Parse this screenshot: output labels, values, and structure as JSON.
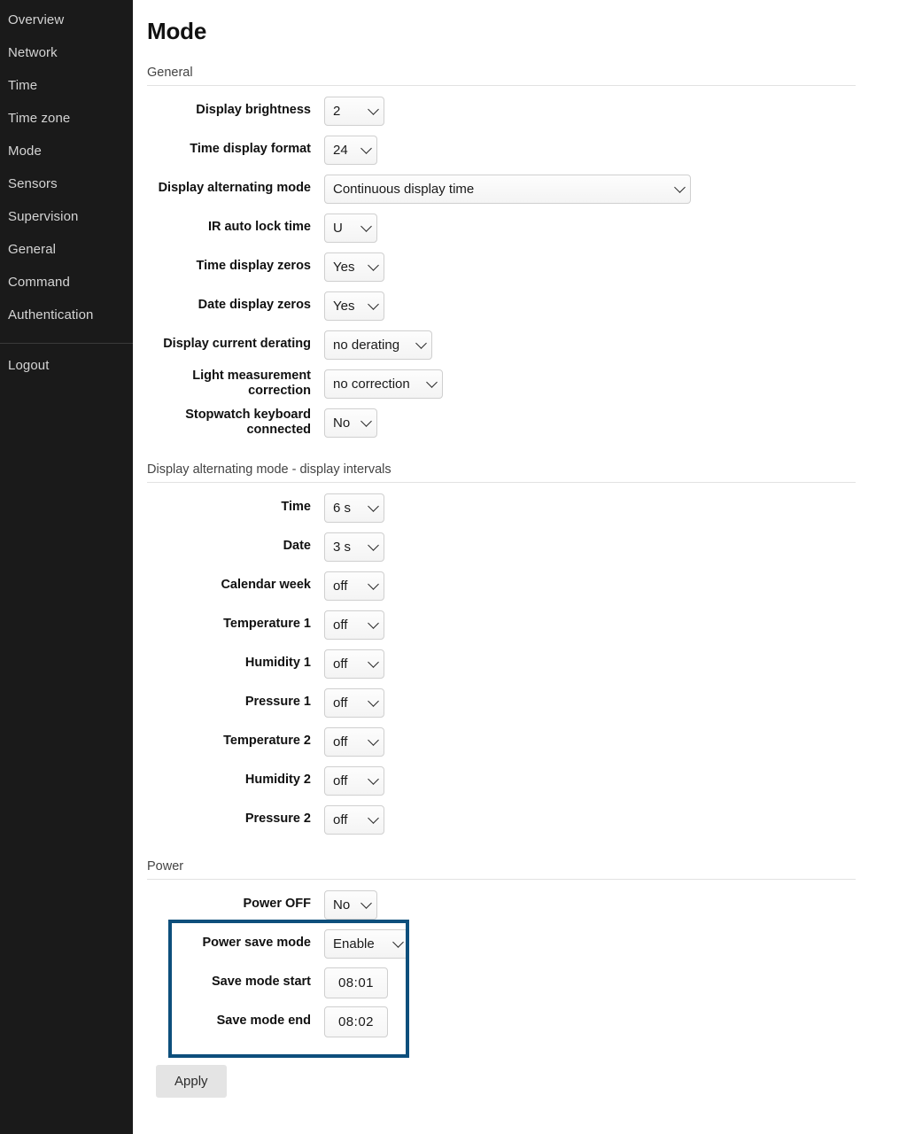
{
  "sidebar": {
    "items": [
      {
        "label": "Overview"
      },
      {
        "label": "Network"
      },
      {
        "label": "Time"
      },
      {
        "label": "Time zone"
      },
      {
        "label": "Mode"
      },
      {
        "label": "Sensors"
      },
      {
        "label": "Supervision"
      },
      {
        "label": "General"
      },
      {
        "label": "Command"
      },
      {
        "label": "Authentication"
      }
    ],
    "logout": "Logout"
  },
  "page": {
    "title": "Mode",
    "apply_label": "Apply",
    "highlight_color": "#0d4f7c"
  },
  "sections": {
    "general": {
      "heading": "General",
      "rows": [
        {
          "label": "Display brightness",
          "value": "2",
          "control": "select"
        },
        {
          "label": "Time display format",
          "value": "24",
          "control": "select"
        },
        {
          "label": "Display alternating mode",
          "value": "Continuous display time",
          "control": "select"
        },
        {
          "label": "IR auto lock time",
          "value": "U",
          "control": "select"
        },
        {
          "label": "Time display zeros",
          "value": "Yes",
          "control": "select"
        },
        {
          "label": "Date display zeros",
          "value": "Yes",
          "control": "select"
        },
        {
          "label": "Display current derating",
          "value": "no derating",
          "control": "select"
        },
        {
          "label": "Light measurement correction",
          "value": "no correction",
          "control": "select"
        },
        {
          "label": "Stopwatch keyboard connected",
          "value": "No",
          "control": "select"
        }
      ]
    },
    "intervals": {
      "heading": "Display alternating mode - display intervals",
      "rows": [
        {
          "label": "Time",
          "value": "6 s",
          "control": "select"
        },
        {
          "label": "Date",
          "value": "3 s",
          "control": "select"
        },
        {
          "label": "Calendar week",
          "value": "off",
          "control": "select"
        },
        {
          "label": "Temperature 1",
          "value": "off",
          "control": "select"
        },
        {
          "label": "Humidity 1",
          "value": "off",
          "control": "select"
        },
        {
          "label": "Pressure 1",
          "value": "off",
          "control": "select"
        },
        {
          "label": "Temperature 2",
          "value": "off",
          "control": "select"
        },
        {
          "label": "Humidity 2",
          "value": "off",
          "control": "select"
        },
        {
          "label": "Pressure 2",
          "value": "off",
          "control": "select"
        }
      ]
    },
    "power": {
      "heading": "Power",
      "rows": [
        {
          "label": "Power OFF",
          "value": "No",
          "control": "select"
        },
        {
          "label": "Power save mode",
          "value": "Enable",
          "control": "select"
        },
        {
          "label": "Save mode start",
          "value": "08:01",
          "control": "time"
        },
        {
          "label": "Save mode end",
          "value": "08:02",
          "control": "time"
        }
      ]
    }
  }
}
